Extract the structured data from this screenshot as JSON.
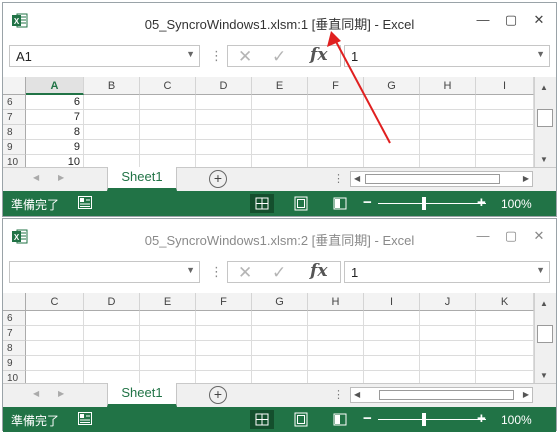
{
  "windows": [
    {
      "title": "05_SyncroWindows1.xlsm:1  [垂直同期] - Excel",
      "name_box": "A1",
      "formula_value": "1",
      "columns": [
        "A",
        "B",
        "C",
        "D",
        "E",
        "F",
        "G",
        "H",
        "I"
      ],
      "selected_column": "A",
      "rows": [
        {
          "num": "6",
          "value": "6"
        },
        {
          "num": "7",
          "value": "7"
        },
        {
          "num": "8",
          "value": "8"
        },
        {
          "num": "9",
          "value": "9"
        },
        {
          "num": "10",
          "value": "10"
        }
      ],
      "sheet_tab": "Sheet1",
      "status": "準備完了",
      "zoom": "100%"
    },
    {
      "title": "05_SyncroWindows1.xlsm:2  [垂直同期] - Excel",
      "name_box": "",
      "formula_value": "1",
      "columns": [
        "C",
        "D",
        "E",
        "F",
        "G",
        "H",
        "I",
        "J",
        "K"
      ],
      "rows": [
        {
          "num": "6",
          "value": ""
        },
        {
          "num": "7",
          "value": ""
        },
        {
          "num": "8",
          "value": ""
        },
        {
          "num": "9",
          "value": ""
        },
        {
          "num": "10",
          "value": ""
        }
      ],
      "sheet_tab": "Sheet1",
      "status": "準備完了",
      "zoom": "100%"
    }
  ],
  "colors": {
    "excel_green": "#217346",
    "annotation_arrow": "#e02020"
  }
}
